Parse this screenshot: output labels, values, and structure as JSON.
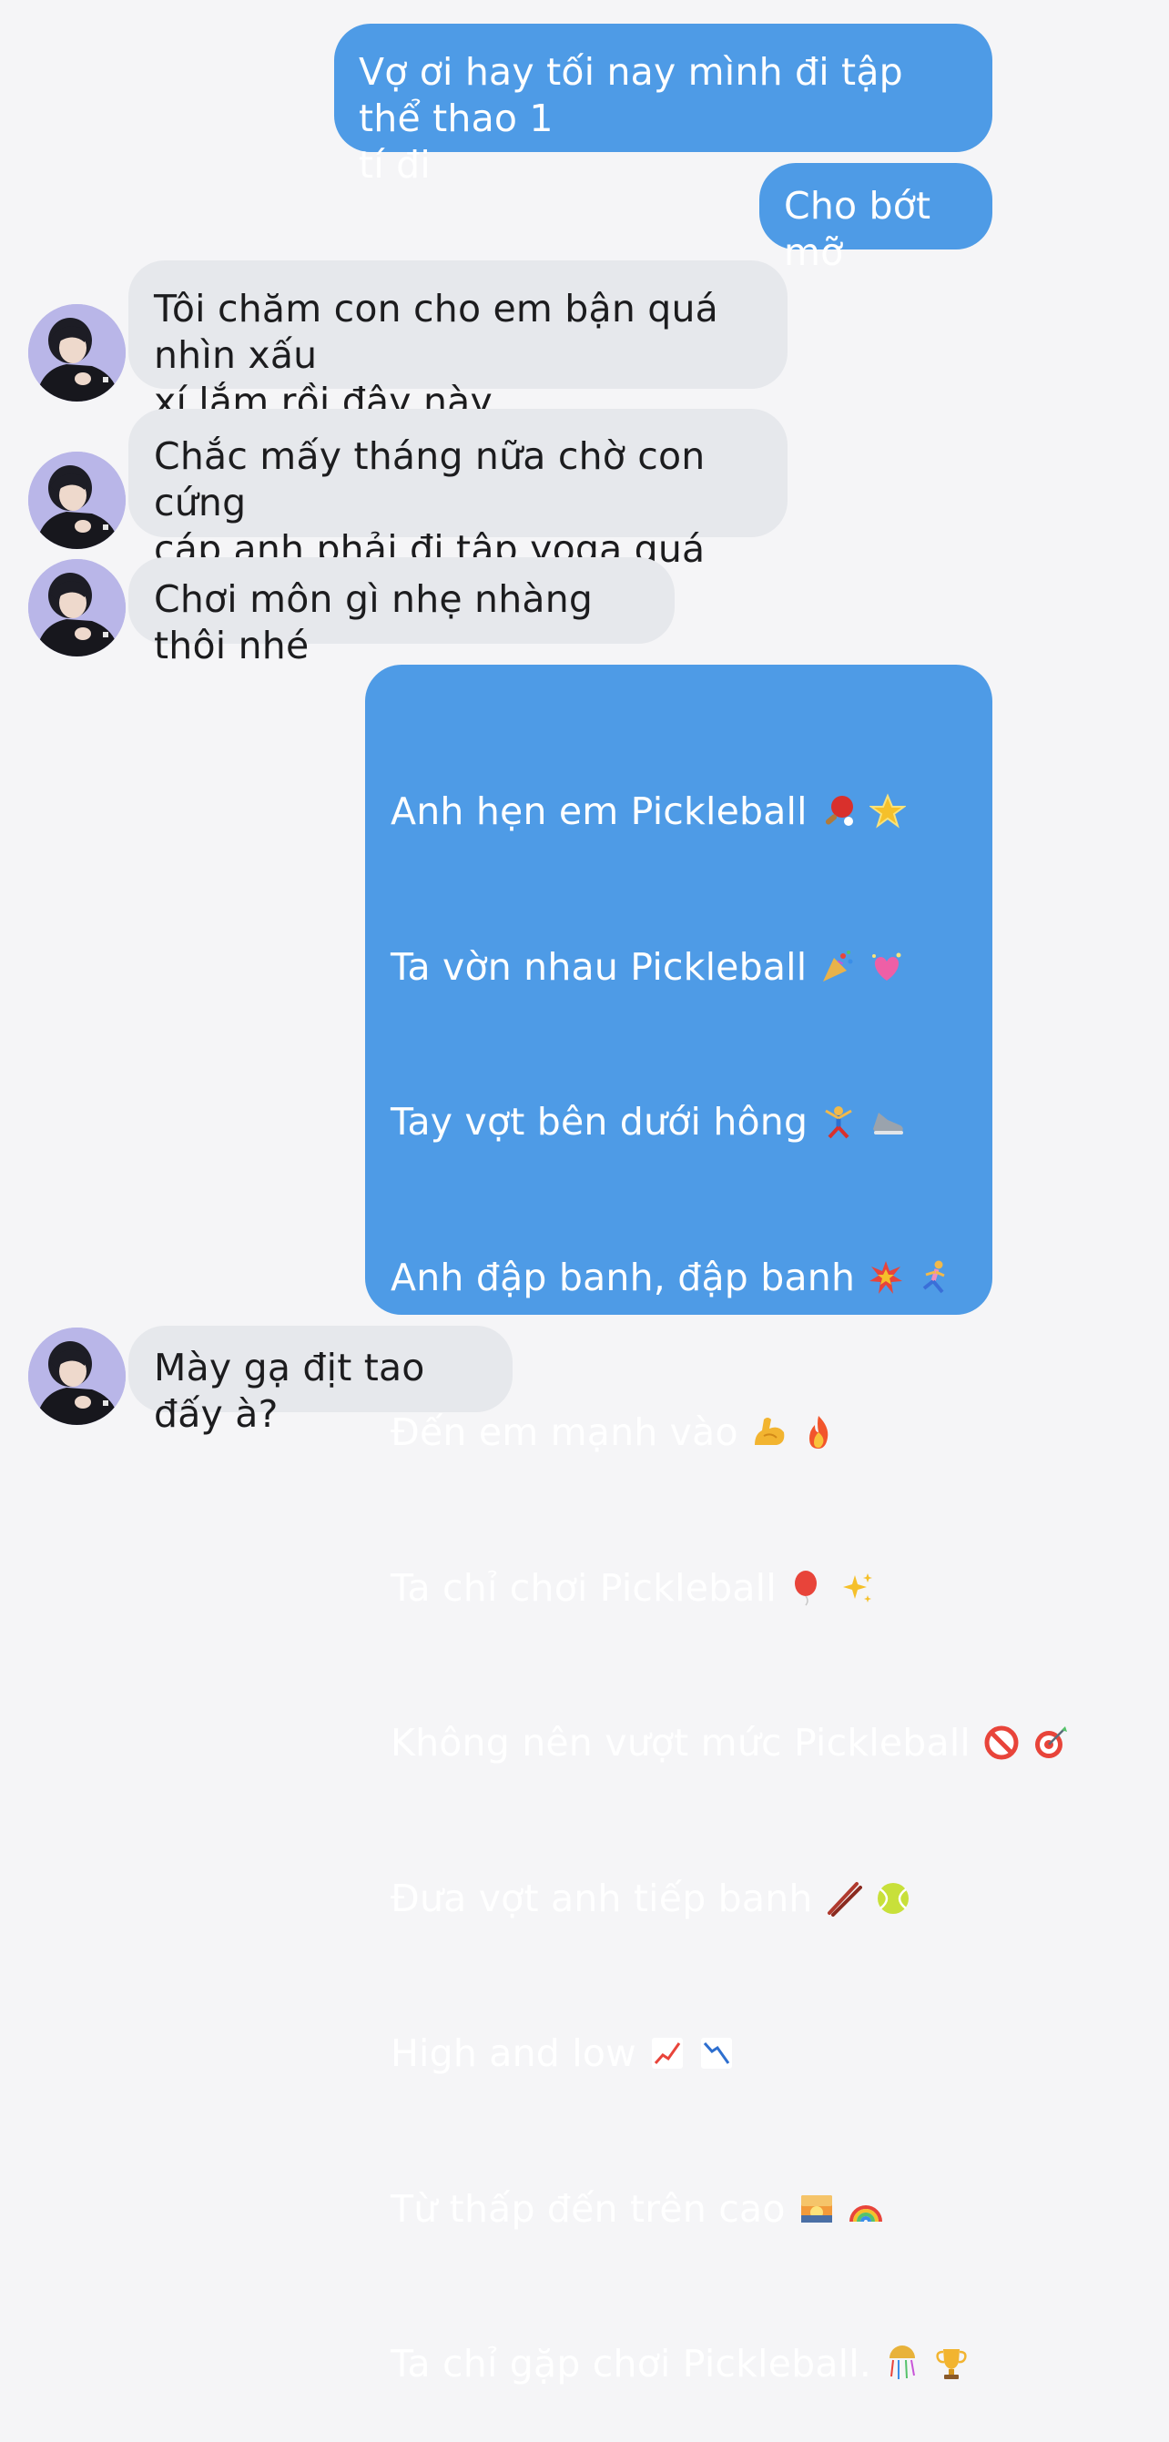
{
  "messages": [
    {
      "id": "m1",
      "dir": "out",
      "text": "Vợ ơi hay tối nay mình đi tập thể thao 1\ntí đi"
    },
    {
      "id": "m2",
      "dir": "out",
      "text": "Cho bớt mỡ"
    },
    {
      "id": "m3",
      "dir": "in",
      "text": "Tôi chăm con cho em bận quá nhìn xấu\nxí lắm rồi đây này"
    },
    {
      "id": "m4",
      "dir": "in",
      "text": "Chắc mấy tháng nữa chờ con cứng\ncáp anh phải đi tập yoga quá"
    },
    {
      "id": "m5",
      "dir": "in",
      "text": "Chơi môn gì nhẹ nhàng thôi nhé"
    },
    {
      "id": "m7",
      "dir": "in",
      "text": "Mày gạ địt tao đấy à?"
    }
  ],
  "song": {
    "lines": [
      {
        "text": "Anh hẹn em Pickleball",
        "emojis": [
          "ping-pong-paddle",
          "glowing-star"
        ]
      },
      {
        "text": "Ta vờn nhau Pickleball",
        "emojis": [
          "party-popper",
          "sparkling-heart"
        ]
      },
      {
        "text": "Tay vợt bên dưới hông",
        "emojis": [
          "person-cartwheeling",
          "running-shoe"
        ]
      },
      {
        "text": "Anh đập banh, đập banh",
        "emojis": [
          "collision",
          "person-running"
        ]
      },
      {
        "text": "Đến em mạnh vào",
        "emojis": [
          "flexed-biceps",
          "fire"
        ]
      },
      {
        "text": "Ta chỉ chơi Pickleball",
        "emojis": [
          "balloon",
          "sparkles"
        ]
      },
      {
        "text": "Không nên vượt mức Pickleball",
        "emojis": [
          "no-entry-sign",
          "direct-hit"
        ]
      },
      {
        "text": "Đưa vợt anh tiếp banh",
        "emojis": [
          "chopsticks",
          "tennis-ball"
        ]
      },
      {
        "text": "High and low",
        "emojis": [
          "chart-increasing",
          "chart-decreasing"
        ]
      },
      {
        "text": "Từ thấp đến trên cao",
        "emojis": [
          "sunrise",
          "rainbow"
        ]
      },
      {
        "text": "Ta chỉ gặp chơi Pickleball.",
        "emojis": [
          "confetti-ball",
          "trophy"
        ]
      }
    ]
  },
  "colors": {
    "outgoing_bubble": "#4e9be6",
    "incoming_bubble": "#e6e8ec",
    "background": "#f5f5f7"
  }
}
